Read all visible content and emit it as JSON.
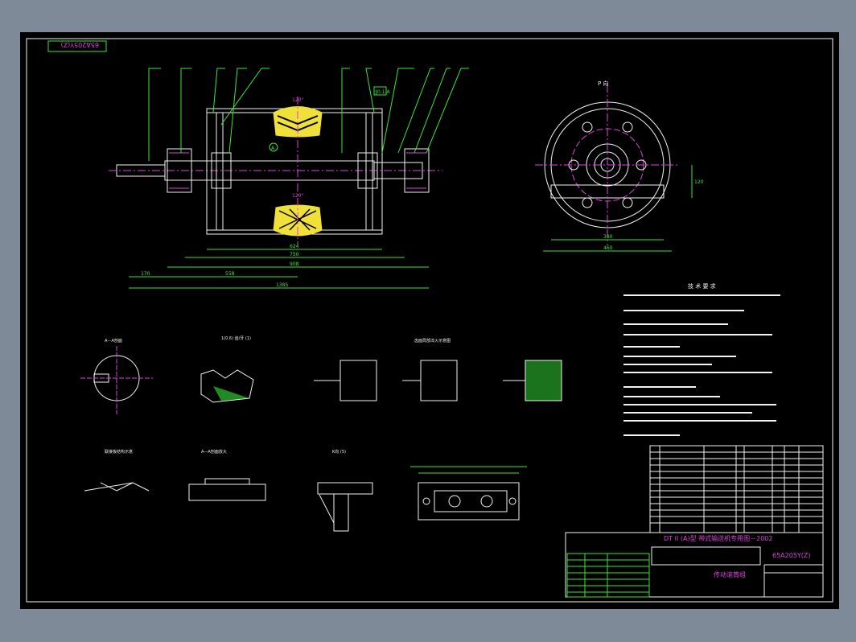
{
  "drawing": {
    "top_left_code": "65A205Y(Z)",
    "drawing_code": "65A205Y(Z)",
    "series_title": "DT II (A)型  带式输送机专用图－2002",
    "part_name": "传动滚筒组",
    "tech_requirements_title": "技  术  要  求",
    "section_view_a": "A－A剖面",
    "gear_label": "1(0.6) 齿/牙 (1)",
    "heat_treat_title": "齿面局部淬火示意图",
    "flange_title": "联接板结构示意",
    "rubber_detail": "A—A剖面放大",
    "detail_k": "K向  (5)",
    "detail_p": "P 向",
    "dims": {
      "total_length": "1385",
      "shaft_span": "908",
      "inner_span": "750",
      "face_width": "624",
      "left_ext": "170",
      "mid_ext": "558",
      "end_dia_w": "380",
      "end_dia_total": "460",
      "center_h": "120"
    },
    "surface_angle_top": "120°",
    "surface_angle_bottom": "120°"
  },
  "colors": {
    "background": "#000000",
    "outer_frame": "#7f8a99",
    "line_green": "#36e836",
    "line_white": "#f2f2f2",
    "line_magenta": "#e040e0",
    "fill_yellow": "#f0e03a"
  }
}
